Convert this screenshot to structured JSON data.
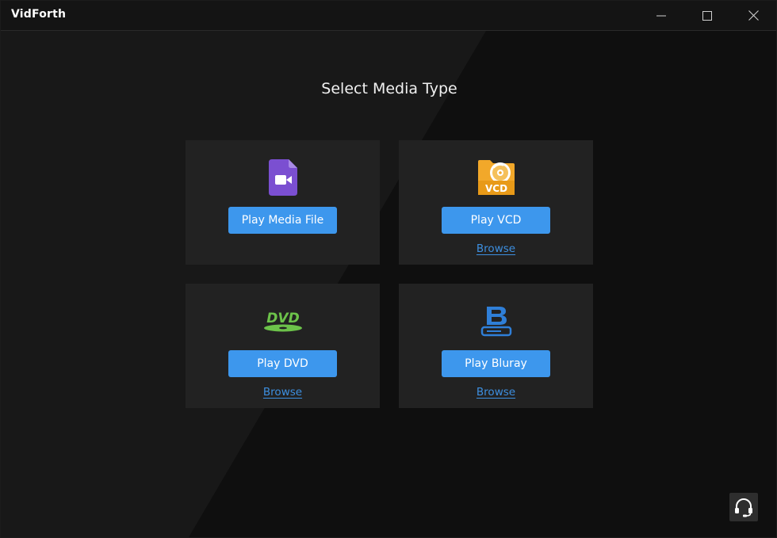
{
  "window": {
    "title": "VidForth",
    "controls": [
      "minimize",
      "maximize",
      "close"
    ]
  },
  "main": {
    "heading": "Select Media Type",
    "cards": [
      {
        "id": "media",
        "icon": "video-file-icon",
        "button_label": "Play Media File",
        "browse_label": null
      },
      {
        "id": "vcd",
        "icon": "vcd-folder-icon",
        "icon_text": "VCD",
        "button_label": "Play VCD",
        "browse_label": "Browse"
      },
      {
        "id": "dvd",
        "icon": "dvd-logo-icon",
        "icon_text": "DVD",
        "button_label": "Play DVD",
        "browse_label": "Browse"
      },
      {
        "id": "bluray",
        "icon": "bluray-logo-icon",
        "button_label": "Play Bluray",
        "browse_label": "Browse"
      }
    ]
  },
  "support": {
    "icon": "headset-icon"
  },
  "colors": {
    "accent": "#3d97ed",
    "link": "#3d8fe0",
    "card_bg": "#222222",
    "window_bg": "#0f0f0f",
    "media_icon": "#7b4fd1",
    "vcd_icon": "#f2a82a",
    "dvd_icon": "#6cc24a",
    "bluray_icon": "#2f7fd8"
  }
}
